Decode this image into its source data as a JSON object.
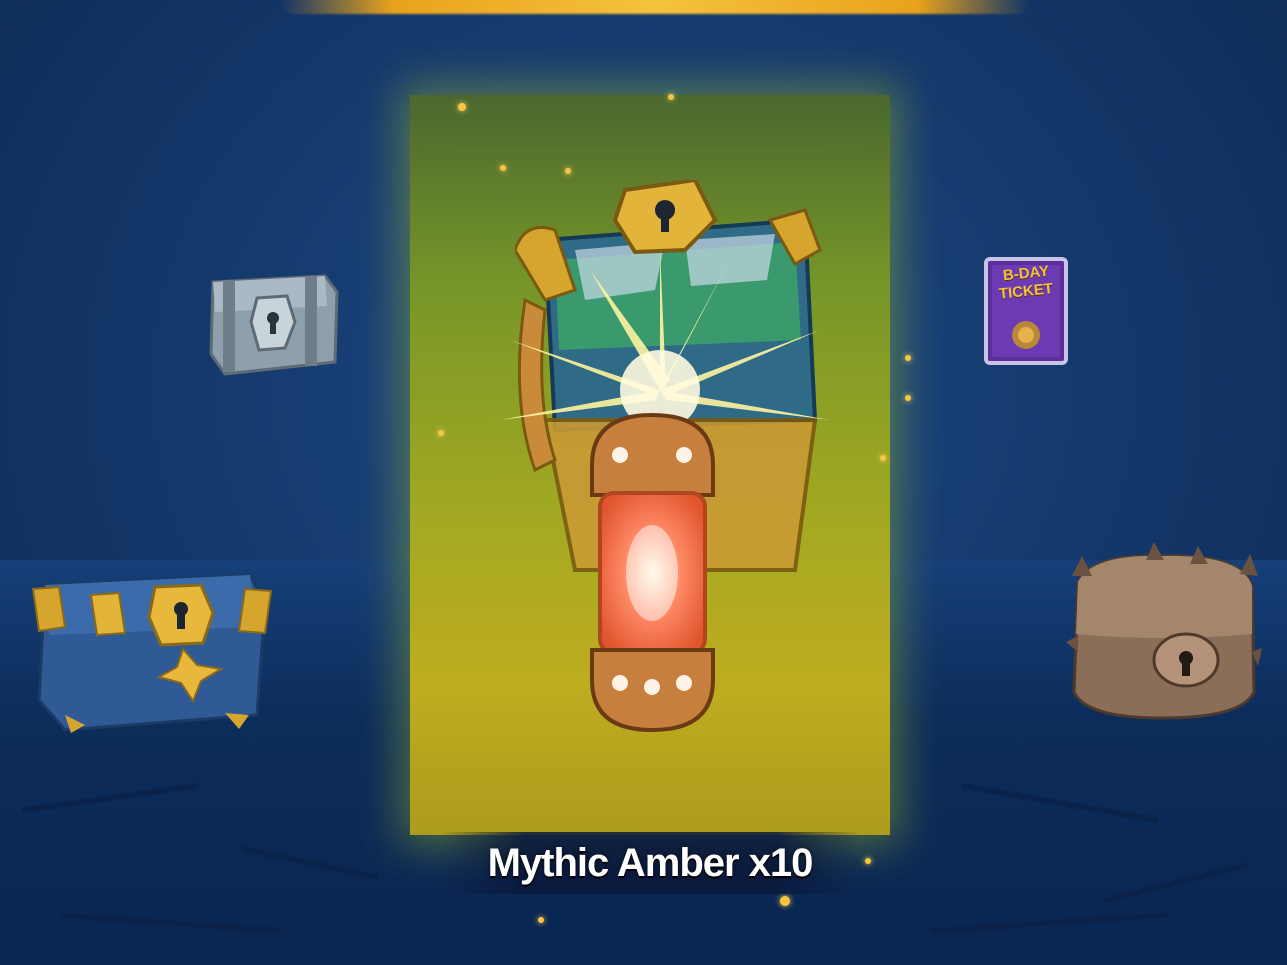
{
  "reward": {
    "name": "Mythic Amber x10"
  },
  "side_items": [
    {
      "name": "silver-chest-icon"
    },
    {
      "name": "blue-gold-chest-icon"
    },
    {
      "name": "bday-ticket-card",
      "text_lines": [
        "B-DAY",
        "TICKET"
      ]
    },
    {
      "name": "spiked-bronze-chest-icon"
    }
  ],
  "colors": {
    "background": "#153a6e",
    "beam": "#a8ae1e",
    "gold": "#f2c23b",
    "label_text": "#ffffff",
    "ticket_card": "#5b2f9e"
  }
}
